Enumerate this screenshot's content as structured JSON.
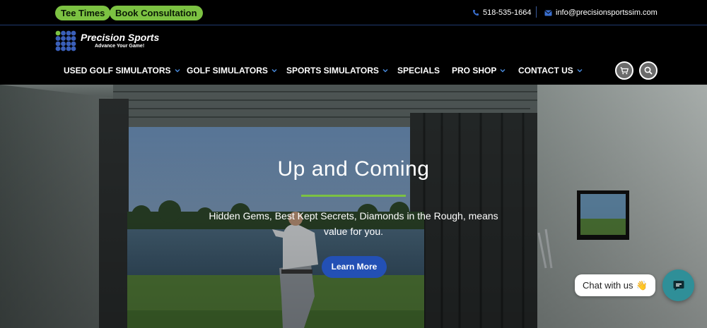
{
  "topbar": {
    "tee_times": "Tee Times",
    "book_consultation": "Book Consultation",
    "phone": "518-535-1664",
    "email": "info@precisionsportssim.com"
  },
  "brand": {
    "name": "Precision Sports",
    "tagline": "Advance Your Game!"
  },
  "nav": {
    "items": [
      {
        "label": "USED GOLF SIMULATORS",
        "has_dropdown": true
      },
      {
        "label": "GOLF SIMULATORS",
        "has_dropdown": true
      },
      {
        "label": "SPORTS SIMULATORS",
        "has_dropdown": true
      },
      {
        "label": "SPECIALS",
        "has_dropdown": false
      },
      {
        "label": "PRO SHOP",
        "has_dropdown": true
      },
      {
        "label": "CONTACT US",
        "has_dropdown": true
      }
    ]
  },
  "hero": {
    "title": "Up and Coming",
    "text": "Hidden Gems, Best Kept Secrets, Diamonds in the Rough, means value for you.",
    "cta": "Learn More"
  },
  "chat": {
    "label": "Chat with us",
    "emoji": "👋"
  },
  "colors": {
    "accent_green": "#7cc242",
    "button_blue": "#2350b5",
    "chat_teal": "#2f8f98"
  },
  "icons": [
    "phone-icon",
    "mail-icon",
    "cart-icon",
    "search-icon",
    "chevron-down-icon",
    "chat-icon"
  ]
}
